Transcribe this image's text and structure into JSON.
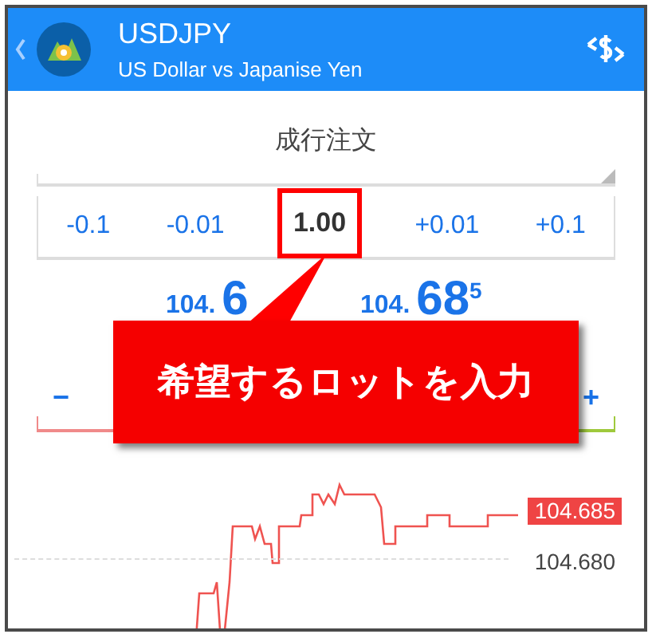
{
  "header": {
    "title": "USDJPY",
    "subtitle": "US Dollar vs Japanise Yen"
  },
  "order_type": {
    "label": "成行注文"
  },
  "lot_steps": [
    {
      "label": "-0.1",
      "kind": "step",
      "highlighted": false
    },
    {
      "label": "-0.01",
      "kind": "step",
      "highlighted": false
    },
    {
      "label": "1.00",
      "kind": "value",
      "highlighted": true
    },
    {
      "label": "+0.01",
      "kind": "step",
      "highlighted": false
    },
    {
      "label": "+0.1",
      "kind": "step",
      "highlighted": false
    }
  ],
  "prices": [
    {
      "prefix": "104.",
      "big": "6"
    },
    {
      "prefix": "104.",
      "big": "68",
      "superscript": "5"
    }
  ],
  "volume_buttons": [
    "−",
    "+"
  ],
  "annotation": {
    "text": "希望するロットを入力"
  },
  "chart": {
    "price_labels": [
      {
        "text": "104.685",
        "kind": "current"
      },
      {
        "text": "104.680",
        "kind": "grid"
      }
    ]
  }
}
